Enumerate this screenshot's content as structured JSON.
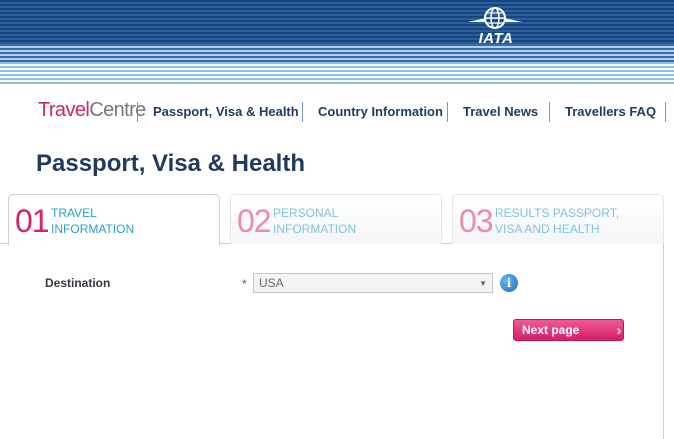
{
  "header": {
    "logo_text": "IATA",
    "colors": {
      "band": "#17457f",
      "accent": "#d4236c"
    }
  },
  "nav": {
    "brand_part1": "Travel",
    "brand_part2": "Centre",
    "links": [
      "Passport, Visa & Health",
      "Country Information",
      "Travel News",
      "Travellers FAQ"
    ]
  },
  "page": {
    "title": "Passport, Visa & Health"
  },
  "tabs": [
    {
      "number": "01",
      "line1": "TRAVEL",
      "line2": "INFORMATION",
      "active": true
    },
    {
      "number": "02",
      "line1": "PERSONAL",
      "line2": "INFORMATION",
      "active": false
    },
    {
      "number": "03",
      "line1": "RESULTS PASSPORT,",
      "line2": "VISA AND HEALTH",
      "active": false
    }
  ],
  "form": {
    "destination_label": "Destination",
    "required_marker": "*",
    "destination_value": "USA",
    "info_icon": "i",
    "next_button": "Next page",
    "next_chevrons": "›››"
  }
}
